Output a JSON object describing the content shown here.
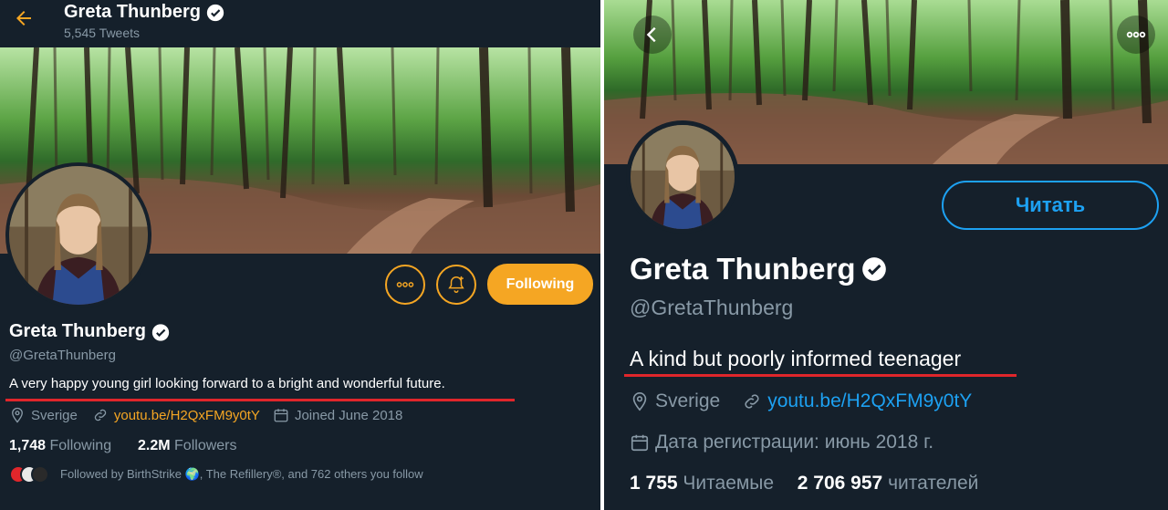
{
  "left": {
    "header": {
      "title": "Greta Thunberg",
      "tweets": "5,545 Tweets"
    },
    "buttons": {
      "following": "Following"
    },
    "profile": {
      "name": "Greta Thunberg",
      "handle": "@GretaThunberg",
      "bio": "A very happy young girl looking forward to a bright and wonderful future.",
      "location": "Sverige",
      "link": "youtu.be/H2QxFM9y0tY",
      "joined": "Joined June 2018"
    },
    "stats": {
      "following_count": "1,748",
      "following_label": "Following",
      "followers_count": "2.2M",
      "followers_label": "Followers"
    },
    "followed_by": "Followed by BirthStrike 🌍, The Refillery®, and 762 others you follow"
  },
  "right": {
    "buttons": {
      "follow": "Читать"
    },
    "profile": {
      "name": "Greta Thunberg",
      "handle": "@GretaThunberg",
      "bio": "A kind but poorly informed teenager",
      "location": "Sverige",
      "link": "youtu.be/H2QxFM9y0tY",
      "joined": "Дата регистрации: июнь 2018 г."
    },
    "stats": {
      "following_count": "1 755",
      "following_label": "Читаемые",
      "followers_count": "2 706 957",
      "followers_label": "читателей"
    }
  },
  "colors": {
    "background": "#15202b",
    "accent_left": "#f5a623",
    "accent_right": "#1da1f2",
    "underline": "#e0262b",
    "muted": "#8899a6"
  },
  "icons": [
    "back-arrow-icon",
    "verified-icon",
    "more-icon",
    "bell-plus-icon",
    "location-icon",
    "link-icon",
    "calendar-icon",
    "chevron-left-icon"
  ]
}
